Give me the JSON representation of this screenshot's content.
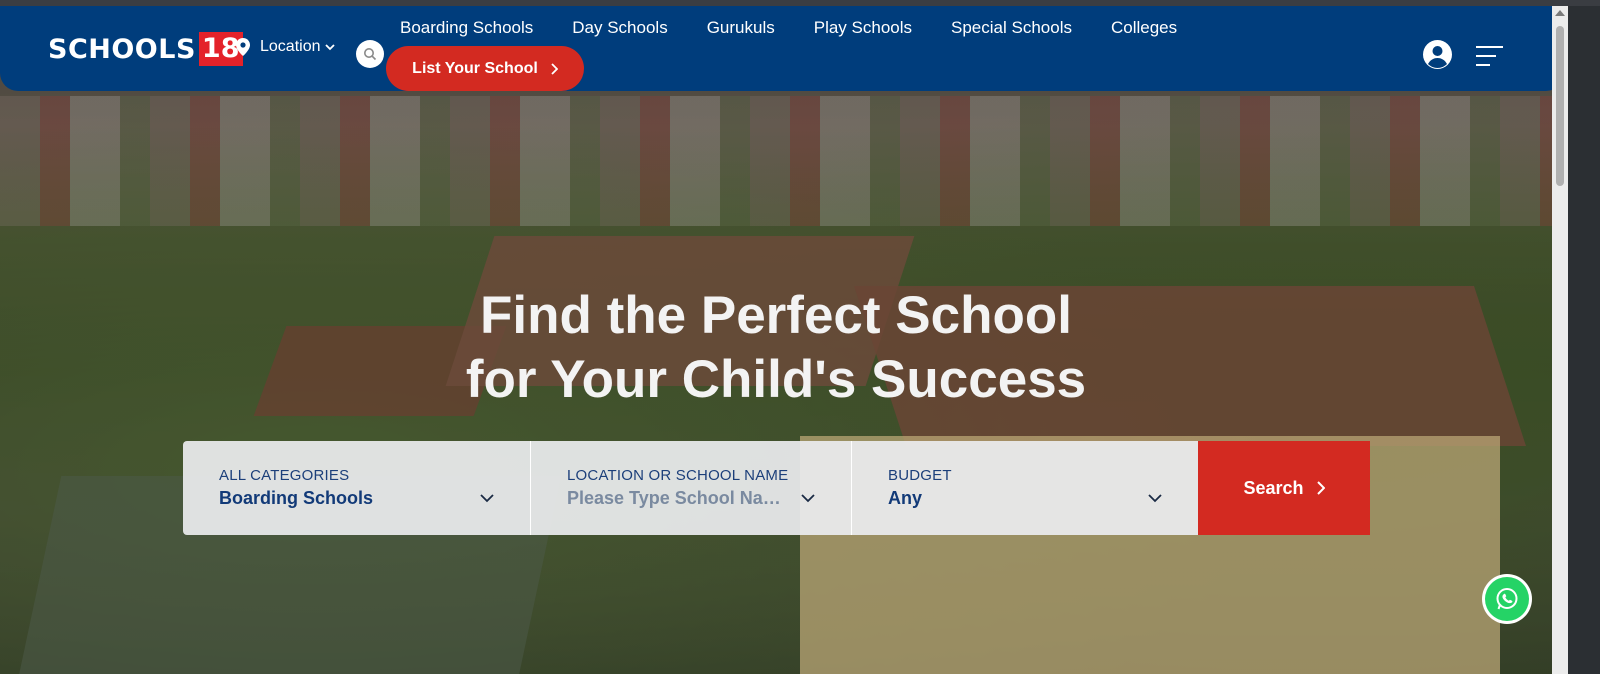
{
  "header": {
    "logo_text": "SCHOOLS",
    "logo_number": "18",
    "location_label": "Location",
    "nav": [
      "Boarding Schools",
      "Day Schools",
      "Gurukuls",
      "Play Schools",
      "Special Schools",
      "Colleges"
    ],
    "list_school_label": "List Your School"
  },
  "hero": {
    "headline_line1": "Find the Perfect School",
    "headline_line2": "for Your Child's Success"
  },
  "search": {
    "category_label": "ALL CATEGORIES",
    "category_value": "Boarding Schools",
    "location_label": "LOCATION OR SCHOOL NAME",
    "location_placeholder": "Please Type School Name",
    "budget_label": "BUDGET",
    "budget_value": "Any",
    "button_label": "Search"
  },
  "colors": {
    "header_bg": "#003d7c",
    "accent_red": "#d32a21",
    "whatsapp_green": "#25d366"
  }
}
